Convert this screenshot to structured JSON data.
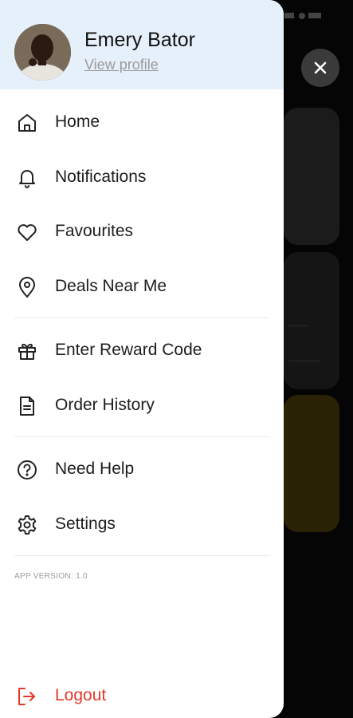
{
  "profile": {
    "name": "Emery Bator",
    "link": "View profile"
  },
  "menu": [
    {
      "label": "Home",
      "icon": "home-icon"
    },
    {
      "label": "Notifications",
      "icon": "bell-icon"
    },
    {
      "label": "Favourites",
      "icon": "heart-icon"
    },
    {
      "label": "Deals Near Me",
      "icon": "map-pin-icon"
    },
    {
      "label": "Enter Reward Code",
      "icon": "gift-icon"
    },
    {
      "label": "Order History",
      "icon": "document-icon"
    },
    {
      "label": "Need Help",
      "icon": "help-circle-icon"
    },
    {
      "label": "Settings",
      "icon": "gear-icon"
    }
  ],
  "app_version": "APP VERSION: 1.0",
  "logout": {
    "label": "Logout",
    "icon": "logout-icon",
    "color": "#e23a2a"
  },
  "colors": {
    "profile_bg": "#e6f0fb",
    "drawer_bg": "#ffffff",
    "overlay_bg": "#000000"
  }
}
